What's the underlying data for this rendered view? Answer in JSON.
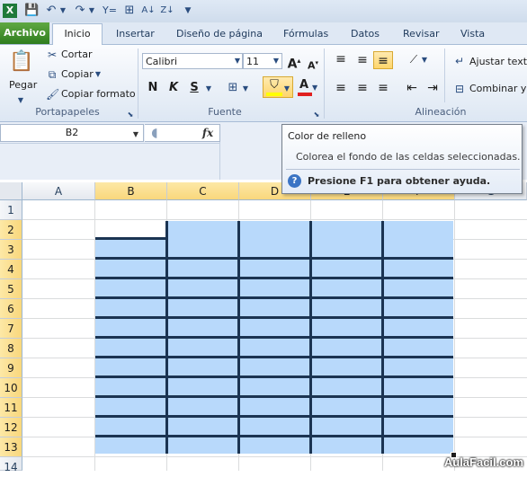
{
  "qat": {
    "icons": [
      "excel-icon",
      "save-icon",
      "undo-icon",
      "redo-icon",
      "filter-icon",
      "borders-icon",
      "sort-asc-icon",
      "sort-desc-icon",
      "customize-icon"
    ]
  },
  "tabs": {
    "file": "Archivo",
    "home": "Inicio",
    "insert": "Insertar",
    "layout": "Diseño de página",
    "formulas": "Fórmulas",
    "data": "Datos",
    "review": "Revisar",
    "view": "Vista"
  },
  "clipboard": {
    "paste": "Pegar",
    "cut": "Cortar",
    "copy": "Copiar",
    "format_painter": "Copiar formato",
    "label": "Portapapeles"
  },
  "font": {
    "name": "Calibri",
    "size": "11",
    "grow": "A",
    "shrink": "A",
    "bold": "N",
    "italic": "K",
    "underline": "S",
    "fill_letter": "A",
    "label": "Fuente",
    "fill_color": "#ffff00",
    "font_color": "#e02020"
  },
  "alignment": {
    "wrap": "Ajustar texto",
    "merge": "Combinar y c",
    "label": "Alineación"
  },
  "namebox": {
    "value": "B2"
  },
  "formula": {
    "fx": "fx"
  },
  "tooltip": {
    "title": "Color de relleno",
    "description": "Colorea el fondo de las celdas seleccionadas.",
    "help": "Presione F1 para obtener ayuda."
  },
  "grid": {
    "columns": [
      "A",
      "B",
      "C",
      "D",
      "E",
      "F",
      "G"
    ],
    "rows": [
      "1",
      "2",
      "3",
      "4",
      "5",
      "6",
      "7",
      "8",
      "9",
      "10",
      "11",
      "12",
      "13",
      "14"
    ],
    "fill_color": "#b8d9fb",
    "border_color": "#1b3452"
  },
  "watermark": "AulaFacil.com"
}
